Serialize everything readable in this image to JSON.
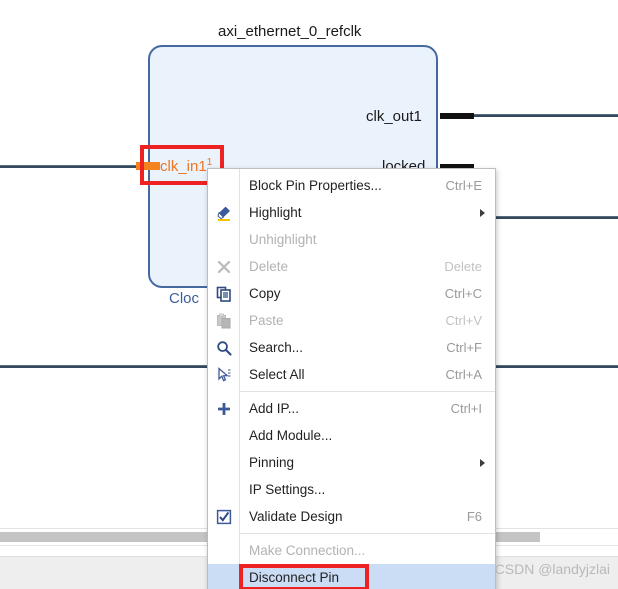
{
  "canvas": {
    "block": {
      "title": "axi_ethernet_0_refclk",
      "subtitle": "Cloc",
      "input_pins": [
        {
          "label": "clk_in1",
          "superscript": "1",
          "selected": true
        }
      ],
      "output_pins": [
        {
          "label": "clk_out1"
        },
        {
          "label": "locked"
        }
      ]
    },
    "colors": {
      "block_fill": "#eaf2fc",
      "block_border": "#45689e",
      "wire": "#34495e",
      "selection": "#ee2222",
      "pin_highlight": "#f58220",
      "subtitle_text": "#3a5fa0"
    }
  },
  "context_menu": {
    "items": [
      {
        "label": "Block Pin Properties...",
        "accel": "Ctrl+E",
        "icon": "",
        "disabled": false,
        "submenu": false,
        "selected": false,
        "separator_after": false
      },
      {
        "label": "Highlight",
        "accel": "",
        "icon": "highlight-icon",
        "disabled": false,
        "submenu": true,
        "selected": false,
        "separator_after": false
      },
      {
        "label": "Unhighlight",
        "accel": "",
        "icon": "",
        "disabled": true,
        "submenu": false,
        "selected": false,
        "separator_after": false
      },
      {
        "label": "Delete",
        "accel": "Delete",
        "icon": "delete-icon",
        "disabled": true,
        "submenu": false,
        "selected": false,
        "separator_after": false
      },
      {
        "label": "Copy",
        "accel": "Ctrl+C",
        "icon": "copy-icon",
        "disabled": false,
        "submenu": false,
        "selected": false,
        "separator_after": false
      },
      {
        "label": "Paste",
        "accel": "Ctrl+V",
        "icon": "paste-icon",
        "disabled": true,
        "submenu": false,
        "selected": false,
        "separator_after": false
      },
      {
        "label": "Search...",
        "accel": "Ctrl+F",
        "icon": "search-icon",
        "disabled": false,
        "submenu": false,
        "selected": false,
        "separator_after": false
      },
      {
        "label": "Select All",
        "accel": "Ctrl+A",
        "icon": "select-all-icon",
        "disabled": false,
        "submenu": false,
        "selected": false,
        "separator_after": true
      },
      {
        "label": "Add IP...",
        "accel": "Ctrl+I",
        "icon": "plus-icon",
        "disabled": false,
        "submenu": false,
        "selected": false,
        "separator_after": false
      },
      {
        "label": "Add Module...",
        "accel": "",
        "icon": "",
        "disabled": false,
        "submenu": false,
        "selected": false,
        "separator_after": false
      },
      {
        "label": "Pinning",
        "accel": "",
        "icon": "",
        "disabled": false,
        "submenu": true,
        "selected": false,
        "separator_after": false
      },
      {
        "label": "IP Settings...",
        "accel": "",
        "icon": "",
        "disabled": false,
        "submenu": false,
        "selected": false,
        "separator_after": false
      },
      {
        "label": "Validate Design",
        "accel": "F6",
        "icon": "validate-icon",
        "disabled": false,
        "submenu": false,
        "selected": false,
        "separator_after": true
      },
      {
        "label": "Make Connection...",
        "accel": "",
        "icon": "",
        "disabled": true,
        "submenu": false,
        "selected": false,
        "separator_after": false
      },
      {
        "label": "Disconnect Pin",
        "accel": "",
        "icon": "",
        "disabled": false,
        "submenu": false,
        "selected": true,
        "separator_after": false
      }
    ]
  },
  "watermark": {
    "text": "CSDN @landyjzlai"
  }
}
